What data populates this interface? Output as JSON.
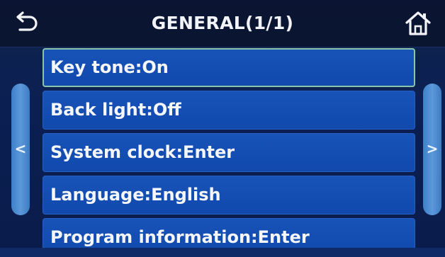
{
  "header": {
    "title": "GENERAL(1/1)",
    "back_icon": "back-arrow-icon",
    "home_icon": "home-icon"
  },
  "nav": {
    "prev_glyph": "<",
    "next_glyph": ">"
  },
  "menu": {
    "items": [
      {
        "label": "Key tone:On",
        "selected": true
      },
      {
        "label": "Back light:Off",
        "selected": false
      },
      {
        "label": "System clock:Enter",
        "selected": false
      },
      {
        "label": "Language:English",
        "selected": false
      },
      {
        "label": "Program information:Enter",
        "selected": false
      }
    ]
  },
  "colors": {
    "background": "#0a1c4b",
    "item": "#1551b6",
    "selected_border": "#89c6a8",
    "side_tab": "#4a8ad0"
  }
}
